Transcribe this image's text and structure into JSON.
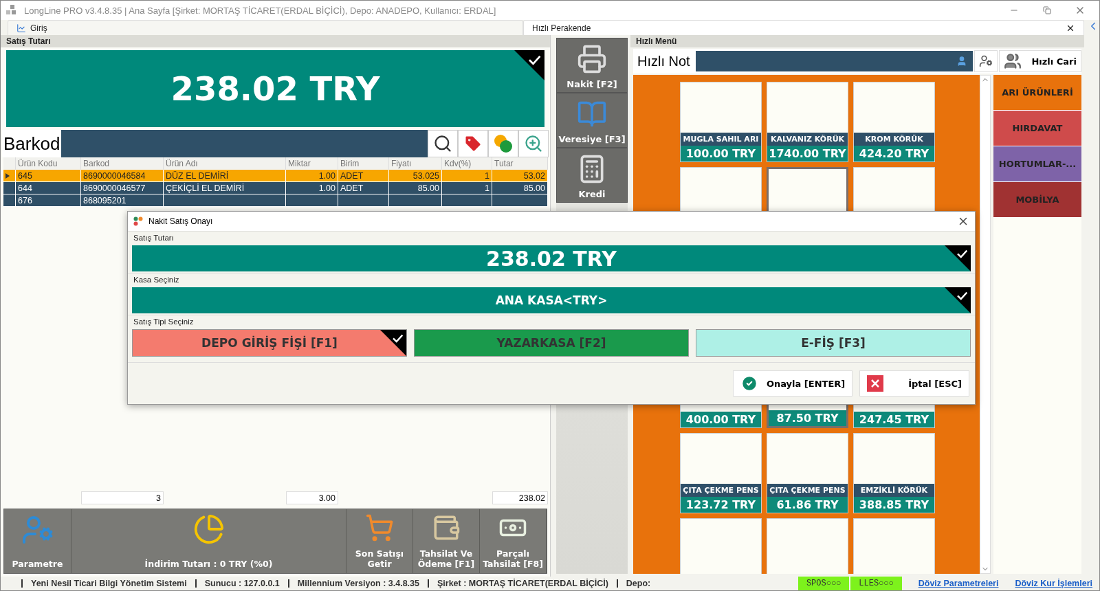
{
  "window": {
    "title": "LongLine PRO v3.4.8.35 | Ana Sayfa [Şirket: MORTAŞ TİCARET(ERDAL BİÇİCİ), Depo: ANADEPO, Kullanıcı: ERDAL]"
  },
  "tabs": [
    {
      "label": "Giriş",
      "selected": false
    },
    {
      "label": "Hızlı Perakende",
      "selected": true
    }
  ],
  "sale_total": {
    "title": "Satış Tutarı",
    "amount": "238.02 TRY",
    "checked": true
  },
  "barcode": {
    "label": "Barkod"
  },
  "table": {
    "columns": [
      "Ürün Kodu",
      "Barkod",
      "Ürün Adı",
      "Miktar",
      "Birim",
      "Fiyatı",
      "Kdv(%)",
      "Tutar"
    ],
    "rows": [
      {
        "selected": true,
        "cells": [
          "645",
          "8690000046584",
          "DÜZ EL DEMİRİ",
          "1.00",
          "ADET",
          "53.025",
          "1",
          "53.02"
        ]
      },
      {
        "selected": false,
        "cells": [
          "644",
          "8690000046577",
          "ÇEKİÇLİ EL DEMİRİ",
          "1.00",
          "ADET",
          "85.00",
          "1",
          "85.00"
        ]
      },
      {
        "selected": false,
        "cells": [
          "676",
          "868095201"
        ]
      }
    ]
  },
  "totals": {
    "count": "3",
    "quantity": "3.00",
    "amount": "238.02"
  },
  "toolbar": [
    {
      "label": "Parametre",
      "kind": "settings"
    },
    {
      "label": "İndirim Tutarı : 0 TRY (%0)",
      "kind": "discount"
    },
    {
      "label": "Son Satışı Getir",
      "kind": "last-sale"
    },
    {
      "label": "Tahsilat Ve Ödeme [F1]",
      "kind": "payment"
    },
    {
      "label": "Parçalı Tahsilat [F8]",
      "kind": "split"
    }
  ],
  "payment_buttons": [
    {
      "label": "Nakit [F2]",
      "kind": "cash"
    },
    {
      "label": "Veresiye [F3]",
      "kind": "account"
    },
    {
      "label": "Kredi",
      "kind": "card"
    }
  ],
  "quick_menu": {
    "title": "Hızlı Menü",
    "note_label": "Hızlı Not",
    "customer_button": "Hızlı Cari",
    "tiles": [
      {
        "name": "MUGLA SAHIL ARI",
        "price": "100.00 TRY",
        "selected": false
      },
      {
        "name": "KALVANIZ KÖRÜK",
        "price": "1740.00 TRY",
        "selected": false
      },
      {
        "name": "KROM KÖRÜK",
        "price": "424.20 TRY",
        "selected": false
      },
      {
        "price": "400.00 TRY",
        "selected": false
      },
      {
        "price": "87.50 TRY",
        "selected": true
      },
      {
        "price": "247.45 TRY",
        "selected": false
      },
      {
        "name": "ÇITA ÇEKME PENS",
        "price": "123.72 TRY",
        "selected": false
      },
      {
        "name": "ÇITA ÇEKME PENS",
        "price": "61.86 TRY",
        "selected": false
      },
      {
        "name": "EMZİKLİ KÖRÜK",
        "price": "388.85 TRY",
        "selected": false
      },
      {
        "selected": false
      },
      {
        "selected": false
      },
      {
        "selected": false
      }
    ],
    "categories": [
      {
        "label": "ARI ÜRÜNLERİ",
        "color": "#e8720c"
      },
      {
        "label": "HIRDAVAT",
        "color": "#cf4b4b"
      },
      {
        "label": "HORTUMLAR-...",
        "color": "#7e63a8"
      },
      {
        "label": "MOBİLYA",
        "color": "#a03232"
      }
    ]
  },
  "dialog": {
    "title": "Nakit Satış Onayı",
    "amount_label": "Satış Tutarı",
    "amount": "238.02 TRY",
    "amount_checked": true,
    "register_label": "Kasa Seçiniz",
    "register": "ANA KASA<TRY>",
    "register_checked": true,
    "type_label": "Satış Tipi Seçiniz",
    "sale_types": [
      {
        "label": "DEPO GİRİŞ FİŞİ [F1]",
        "color": "#f47b6e",
        "selected": true
      },
      {
        "label": "YAZARKASA [F2]",
        "color": "#1a9a4c",
        "selected": false
      },
      {
        "label": "E-FİŞ [F3]",
        "color": "#aef0e6",
        "selected": false
      }
    ],
    "confirm": "Onayla [ENTER]",
    "cancel": "İptal [ESC]"
  },
  "status_bar": {
    "items": [
      {
        "value": "Yeni Nesil Ticari Bilgi Yönetim Sistemi"
      },
      {
        "label": "Sunucu :",
        "value": "127.0.0.1"
      },
      {
        "label": "Millennium Versiyon :",
        "value": "3.4.8.35"
      },
      {
        "label": "Şirket :",
        "value": "MORTAŞ TİCARET(ERDAL BİÇİCİ)"
      },
      {
        "label": "Depo:"
      }
    ],
    "indicators": [
      "SPOS○○○",
      "LLES○○○"
    ],
    "links": [
      "Döviz Parametreleri",
      "Döviz Kur İşlemleri"
    ]
  }
}
